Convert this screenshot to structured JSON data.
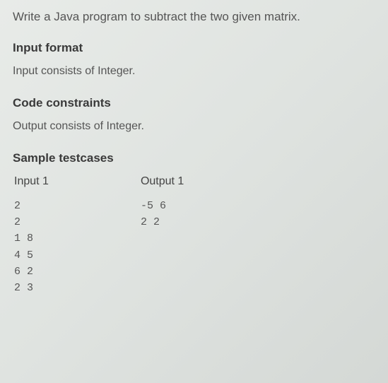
{
  "question": "Write a Java program to subtract the two given matrix.",
  "sections": {
    "input_format": {
      "heading": "Input format",
      "body": "Input consists of Integer."
    },
    "code_constraints": {
      "heading": "Code constraints",
      "body": "Output consists of Integer."
    },
    "sample_testcases": {
      "heading": "Sample testcases"
    }
  },
  "testcase": {
    "input_label": "Input 1",
    "output_label": "Output 1",
    "input_lines": "2\n2\n1 8\n4 5\n6 2\n2 3",
    "output_lines": "-5 6\n2 2"
  }
}
